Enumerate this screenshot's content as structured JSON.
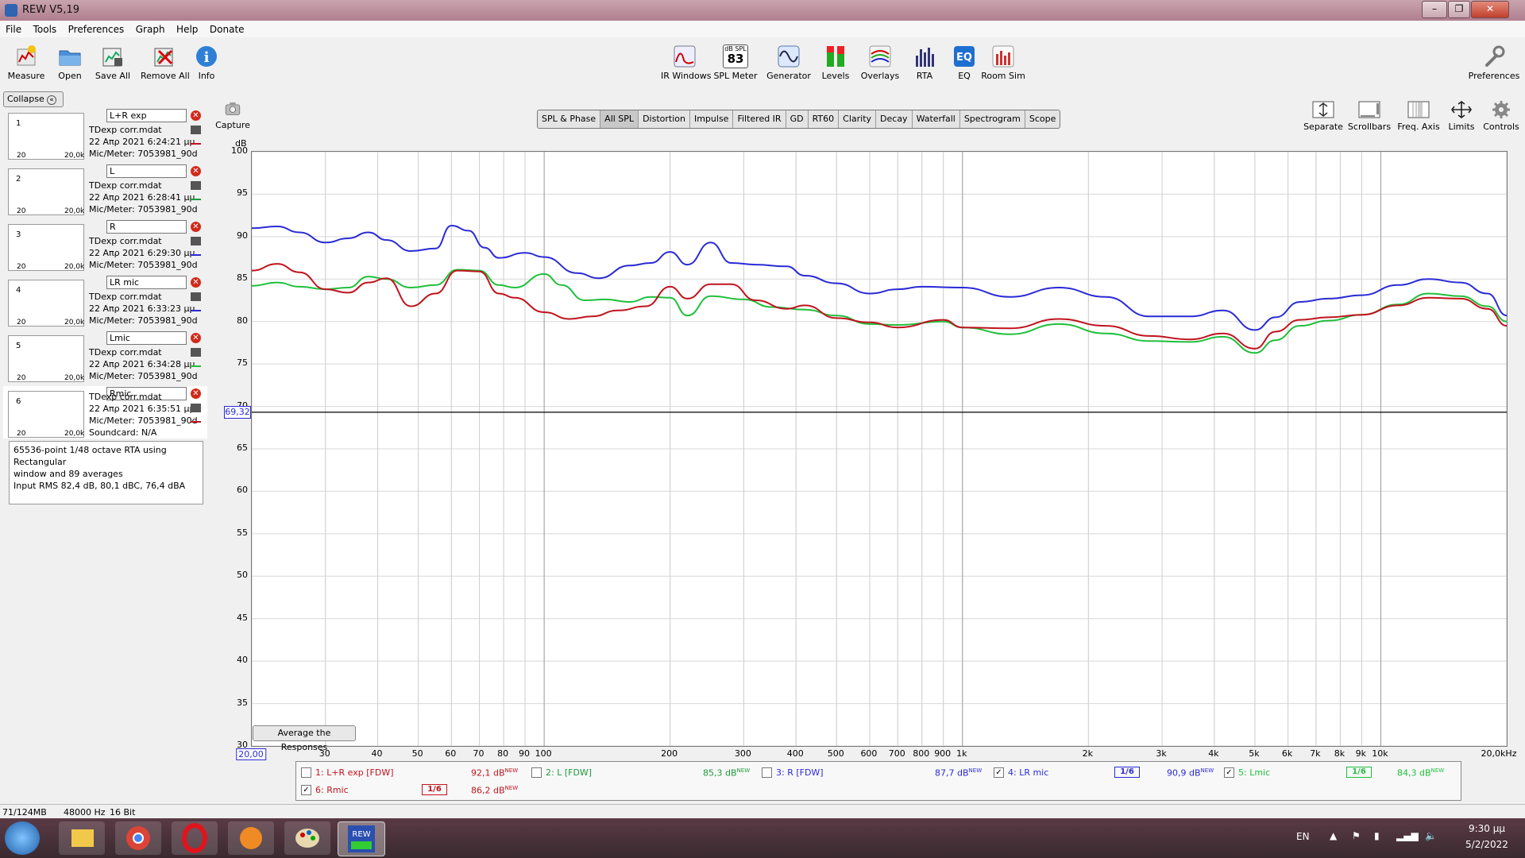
{
  "window": {
    "title": "REW V5,19"
  },
  "menu": [
    "File",
    "Tools",
    "Preferences",
    "Graph",
    "Help",
    "Donate"
  ],
  "toolbar_left": [
    {
      "label": "Measure",
      "icon": "measure-icon"
    },
    {
      "label": "Open",
      "icon": "folder-open-icon"
    },
    {
      "label": "Save All",
      "icon": "save-all-icon"
    },
    {
      "label": "Remove All",
      "icon": "remove-all-icon"
    },
    {
      "label": "Info",
      "icon": "info-icon"
    }
  ],
  "toolbar_center": [
    {
      "label": "IR Windows",
      "icon": "ir-windows-icon"
    },
    {
      "label": "SPL Meter",
      "icon": "spl-meter-icon",
      "badge_top": "dB SPL",
      "badge_value": "83"
    },
    {
      "label": "Generator",
      "icon": "generator-icon"
    },
    {
      "label": "Levels",
      "icon": "levels-icon"
    },
    {
      "label": "Overlays",
      "icon": "overlays-icon"
    },
    {
      "label": "RTA",
      "icon": "rta-icon"
    },
    {
      "label": "EQ",
      "icon": "eq-icon"
    },
    {
      "label": "Room Sim",
      "icon": "room-sim-icon"
    }
  ],
  "preferences_label": "Preferences",
  "capture_label": "Capture",
  "graph_tools": [
    {
      "label": "Separate",
      "icon": "separate-icon"
    },
    {
      "label": "Scrollbars",
      "icon": "scrollbars-icon"
    },
    {
      "label": "Freq. Axis",
      "icon": "freq-axis-icon"
    },
    {
      "label": "Limits",
      "icon": "limits-icon"
    },
    {
      "label": "Controls",
      "icon": "controls-icon"
    }
  ],
  "tabs": [
    "SPL & Phase",
    "All SPL",
    "Distortion",
    "Impulse",
    "Filtered IR",
    "GD",
    "RT60",
    "Clarity",
    "Decay",
    "Waterfall",
    "Spectrogram",
    "Scope"
  ],
  "active_tab": "All SPL",
  "collapse_label": "Collapse",
  "measurements": [
    {
      "num": "1",
      "name": "L+R exp",
      "file": "TDexp corr.mdat",
      "date": "22 Απρ 2021 6:24:21 μμ",
      "mic": "Mic/Meter: 7053981_90d",
      "color": "#c0141e"
    },
    {
      "num": "2",
      "name": "L",
      "file": "TDexp corr.mdat",
      "date": "22 Απρ 2021 6:28:41 μμ",
      "mic": "Mic/Meter: 7053981_90d",
      "color": "#1f9a3c"
    },
    {
      "num": "3",
      "name": "R",
      "file": "TDexp corr.mdat",
      "date": "22 Απρ 2021 6:29:30 μμ",
      "mic": "Mic/Meter: 7053981_90d",
      "color": "#2a2ad6"
    },
    {
      "num": "4",
      "name": "LR mic",
      "file": "TDexp corr.mdat",
      "date": "22 Απρ 2021 6:33:23 μμ",
      "mic": "Mic/Meter: 7053981_90d",
      "color": "#2a2ad6"
    },
    {
      "num": "5",
      "name": "Lmic",
      "file": "TDexp corr.mdat",
      "date": "22 Απρ 2021 6:34:28 μμ",
      "mic": "Mic/Meter: 7053981_90d",
      "color": "#1fbf3c"
    },
    {
      "num": "6",
      "name": "Rmic",
      "file": "TDexp corr.mdat",
      "date": "22 Απρ 2021 6:35:51 μμ",
      "mic": "Mic/Meter: 7053981_90d",
      "soundcard": "Soundcard: N/A",
      "color": "#c0141e"
    }
  ],
  "thumb_axis": {
    "left": "20",
    "right": "20,0k"
  },
  "info_text": [
    "65536-point 1/48 octave RTA using Rectangular",
    "window and 89 averages",
    "Input RMS 82,4 dB, 80,1 dBC, 76,4 dBA"
  ],
  "cursor": {
    "value": "69,32",
    "freq_value": "20,00"
  },
  "average_button": "Average the Responses",
  "legend": [
    {
      "id": "1",
      "label": "1: L+R exp [FDW]",
      "checked": false,
      "value": "92,1 dB",
      "new": "NEW",
      "color": "#c0141e"
    },
    {
      "id": "2",
      "label": "2: L [FDW]",
      "checked": false,
      "value": "85,3 dB",
      "new": "NEW",
      "color": "#1f9a3c"
    },
    {
      "id": "3",
      "label": "3: R [FDW]",
      "checked": false,
      "value": "87,7 dB",
      "new": "NEW",
      "color": "#2a2ad6"
    },
    {
      "id": "4",
      "label": "4: LR mic",
      "checked": true,
      "smoothing": "1/6",
      "value": "90,9 dB",
      "new": "NEW",
      "color": "#2a2ad6"
    },
    {
      "id": "5",
      "label": "5: Lmic",
      "checked": true,
      "smoothing": "1/6",
      "value": "84,3 dB",
      "new": "NEW",
      "color": "#1fbf3c"
    },
    {
      "id": "6",
      "label": "6: Rmic",
      "checked": true,
      "smoothing": "1/6",
      "value": "86,2 dB",
      "new": "NEW",
      "color": "#c0141e"
    }
  ],
  "status": {
    "memory": "71/124MB",
    "rate": "48000 Hz",
    "bits": "16 Bit"
  },
  "taskbar": {
    "lang": "EN",
    "time": "9:30 μμ",
    "date": "5/2/2022"
  },
  "chart_data": {
    "type": "line",
    "ylabel": "dB",
    "ylim": [
      30,
      100
    ],
    "yticks": [
      "100",
      "95",
      "90",
      "85",
      "80",
      "75",
      "70",
      "65",
      "60",
      "55",
      "50",
      "45",
      "40",
      "35",
      "30"
    ],
    "xlim": [
      20,
      20000
    ],
    "x_scale": "log",
    "xticks": [
      {
        "v": 20,
        "label": "20,00"
      },
      {
        "v": 30,
        "label": "30"
      },
      {
        "v": 40,
        "label": "40"
      },
      {
        "v": 50,
        "label": "50"
      },
      {
        "v": 60,
        "label": "60"
      },
      {
        "v": 70,
        "label": "70"
      },
      {
        "v": 80,
        "label": "80"
      },
      {
        "v": 90,
        "label": "90"
      },
      {
        "v": 100,
        "label": "100"
      },
      {
        "v": 200,
        "label": "200"
      },
      {
        "v": 300,
        "label": "300"
      },
      {
        "v": 400,
        "label": "400"
      },
      {
        "v": 500,
        "label": "500"
      },
      {
        "v": 600,
        "label": "600"
      },
      {
        "v": 700,
        "label": "700"
      },
      {
        "v": 800,
        "label": "800"
      },
      {
        "v": 900,
        "label": "900"
      },
      {
        "v": 1000,
        "label": "1k"
      },
      {
        "v": 2000,
        "label": "2k"
      },
      {
        "v": 3000,
        "label": "3k"
      },
      {
        "v": 4000,
        "label": "4k"
      },
      {
        "v": 5000,
        "label": "5k"
      },
      {
        "v": 6000,
        "label": "6k"
      },
      {
        "v": 7000,
        "label": "7k"
      },
      {
        "v": 8000,
        "label": "8k"
      },
      {
        "v": 9000,
        "label": "9k"
      },
      {
        "v": 10000,
        "label": "10k"
      },
      {
        "v": 20000,
        "label": "20,0kHz"
      }
    ],
    "grid": true,
    "cursor_y": 69.32,
    "series": [
      {
        "name": "4: LR mic",
        "color": "#2a2ad6",
        "points": [
          [
            20,
            91
          ],
          [
            23,
            91.2
          ],
          [
            26,
            90.5
          ],
          [
            30,
            89.3
          ],
          [
            34,
            89.8
          ],
          [
            38,
            90.5
          ],
          [
            42,
            89.6
          ],
          [
            48,
            88.3
          ],
          [
            55,
            88.6
          ],
          [
            60,
            91.3
          ],
          [
            66,
            90.7
          ],
          [
            72,
            88.7
          ],
          [
            78,
            87.5
          ],
          [
            90,
            88.1
          ],
          [
            100,
            87.6
          ],
          [
            120,
            85.7
          ],
          [
            135,
            85.1
          ],
          [
            160,
            86.6
          ],
          [
            180,
            86.9
          ],
          [
            200,
            88.2
          ],
          [
            220,
            86.7
          ],
          [
            250,
            89.3
          ],
          [
            280,
            86.9
          ],
          [
            320,
            86.7
          ],
          [
            380,
            86.5
          ],
          [
            420,
            85.4
          ],
          [
            500,
            84.5
          ],
          [
            600,
            83.3
          ],
          [
            700,
            83.8
          ],
          [
            800,
            84.1
          ],
          [
            1000,
            84
          ],
          [
            1300,
            82.9
          ],
          [
            1700,
            84
          ],
          [
            2200,
            82.9
          ],
          [
            2800,
            80.6
          ],
          [
            3500,
            80.6
          ],
          [
            4200,
            81.3
          ],
          [
            5000,
            79
          ],
          [
            5600,
            80.5
          ],
          [
            6400,
            82.3
          ],
          [
            7500,
            82.7
          ],
          [
            9000,
            83.1
          ],
          [
            11000,
            84.3
          ],
          [
            13000,
            85.0
          ],
          [
            15500,
            84.6
          ],
          [
            18000,
            83.3
          ],
          [
            20000,
            80.7
          ]
        ]
      },
      {
        "name": "5: Lmic",
        "color": "#1fbf3c",
        "points": [
          [
            20,
            84.2
          ],
          [
            23,
            84.6
          ],
          [
            26,
            84.1
          ],
          [
            30,
            83.8
          ],
          [
            34,
            84.0
          ],
          [
            38,
            85.3
          ],
          [
            42,
            85.0
          ],
          [
            48,
            84.0
          ],
          [
            55,
            84.3
          ],
          [
            62,
            86.1
          ],
          [
            70,
            86.0
          ],
          [
            78,
            84.3
          ],
          [
            85,
            84.0
          ],
          [
            100,
            85.6
          ],
          [
            110,
            84.3
          ],
          [
            125,
            82.5
          ],
          [
            140,
            82.6
          ],
          [
            160,
            82.3
          ],
          [
            180,
            82.9
          ],
          [
            200,
            82.8
          ],
          [
            220,
            80.7
          ],
          [
            250,
            83.0
          ],
          [
            300,
            82.6
          ],
          [
            350,
            81.7
          ],
          [
            420,
            81.4
          ],
          [
            500,
            80.7
          ],
          [
            600,
            79.7
          ],
          [
            700,
            79.6
          ],
          [
            900,
            80.0
          ],
          [
            1000,
            79.3
          ],
          [
            1300,
            78.5
          ],
          [
            1700,
            79.7
          ],
          [
            2200,
            78.6
          ],
          [
            2800,
            77.7
          ],
          [
            3500,
            77.6
          ],
          [
            4200,
            78.2
          ],
          [
            5000,
            76.3
          ],
          [
            5600,
            77.8
          ],
          [
            6400,
            79.5
          ],
          [
            7500,
            80.1
          ],
          [
            9000,
            80.8
          ],
          [
            11000,
            82.0
          ],
          [
            13000,
            83.3
          ],
          [
            15500,
            83.0
          ],
          [
            18000,
            81.8
          ],
          [
            20000,
            80.0
          ]
        ]
      },
      {
        "name": "6: Rmic",
        "color": "#c0141e",
        "points": [
          [
            20,
            86
          ],
          [
            23,
            86.8
          ],
          [
            26,
            85.8
          ],
          [
            30,
            83.8
          ],
          [
            34,
            83.4
          ],
          [
            38,
            84.6
          ],
          [
            42,
            85.1
          ],
          [
            48,
            81.8
          ],
          [
            55,
            83.3
          ],
          [
            62,
            86.0
          ],
          [
            70,
            85.9
          ],
          [
            78,
            83.3
          ],
          [
            85,
            82.8
          ],
          [
            100,
            81.1
          ],
          [
            115,
            80.3
          ],
          [
            130,
            80.6
          ],
          [
            150,
            81.3
          ],
          [
            175,
            81.8
          ],
          [
            200,
            84.1
          ],
          [
            220,
            82.7
          ],
          [
            250,
            84.4
          ],
          [
            280,
            84.4
          ],
          [
            320,
            82.5
          ],
          [
            380,
            81.5
          ],
          [
            420,
            81.9
          ],
          [
            500,
            80.4
          ],
          [
            600,
            79.9
          ],
          [
            700,
            79.3
          ],
          [
            900,
            80.2
          ],
          [
            1000,
            79.3
          ],
          [
            1300,
            79.2
          ],
          [
            1700,
            80.3
          ],
          [
            2200,
            79.5
          ],
          [
            2800,
            78.3
          ],
          [
            3500,
            77.9
          ],
          [
            4200,
            78.6
          ],
          [
            5000,
            76.8
          ],
          [
            5600,
            78.8
          ],
          [
            6400,
            80.2
          ],
          [
            7500,
            80.5
          ],
          [
            9000,
            80.8
          ],
          [
            11000,
            81.9
          ],
          [
            13000,
            82.8
          ],
          [
            15500,
            82.7
          ],
          [
            18000,
            81.5
          ],
          [
            20000,
            79.5
          ]
        ]
      }
    ]
  }
}
